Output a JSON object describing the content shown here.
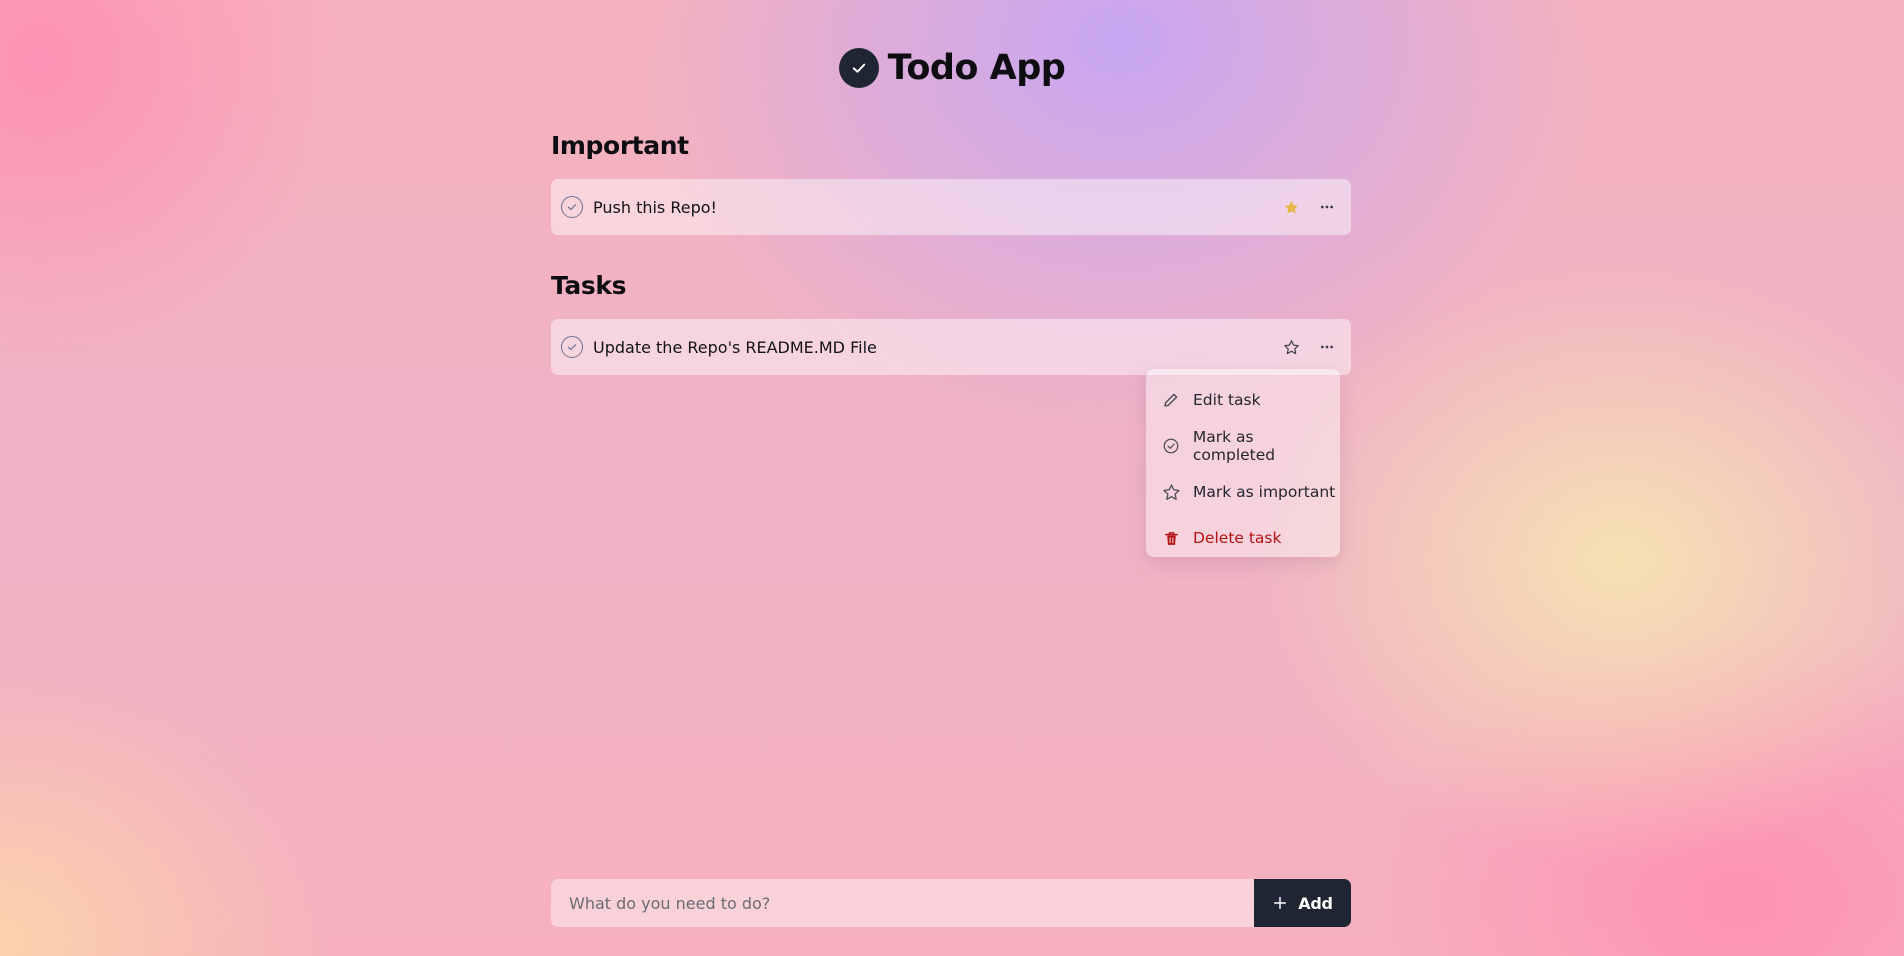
{
  "app": {
    "title": "Todo App",
    "logo_icon": "check-icon",
    "logo_color": "#1f2533"
  },
  "sections": [
    {
      "title": "Important",
      "tasks": [
        {
          "text": "Push this Repo!",
          "important": true,
          "star_color": "#e8b64a"
        }
      ]
    },
    {
      "title": "Tasks",
      "tasks": [
        {
          "text": "Update the Repo's README.MD File",
          "important": false
        }
      ]
    }
  ],
  "context_menu": {
    "items": [
      {
        "label": "Edit task",
        "icon": "pencil-icon"
      },
      {
        "label": "Mark as completed",
        "icon": "check-circle-icon"
      },
      {
        "label": "Mark as important",
        "icon": "star-outline-icon"
      },
      {
        "label": "Delete task",
        "icon": "trash-icon",
        "color": "#b31313"
      }
    ]
  },
  "add_form": {
    "placeholder": "What do you need to do?",
    "button_label": "Add",
    "button_icon": "plus-icon",
    "button_color": "#1f2533"
  }
}
